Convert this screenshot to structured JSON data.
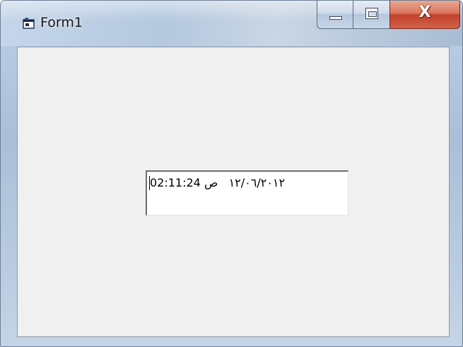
{
  "window": {
    "title": "Form1",
    "icon": "vb-form-icon",
    "controls": {
      "minimize": "minimize-icon",
      "maximize": "maximize-icon",
      "close": "close-icon"
    }
  },
  "textbox": {
    "value": "02:11:24 ١٢/٠٦/٢٠١٢   ص"
  },
  "colors": {
    "client_background": "#f0f0f0",
    "close_button": "#c2412a",
    "frame": "#b8cbe2"
  }
}
